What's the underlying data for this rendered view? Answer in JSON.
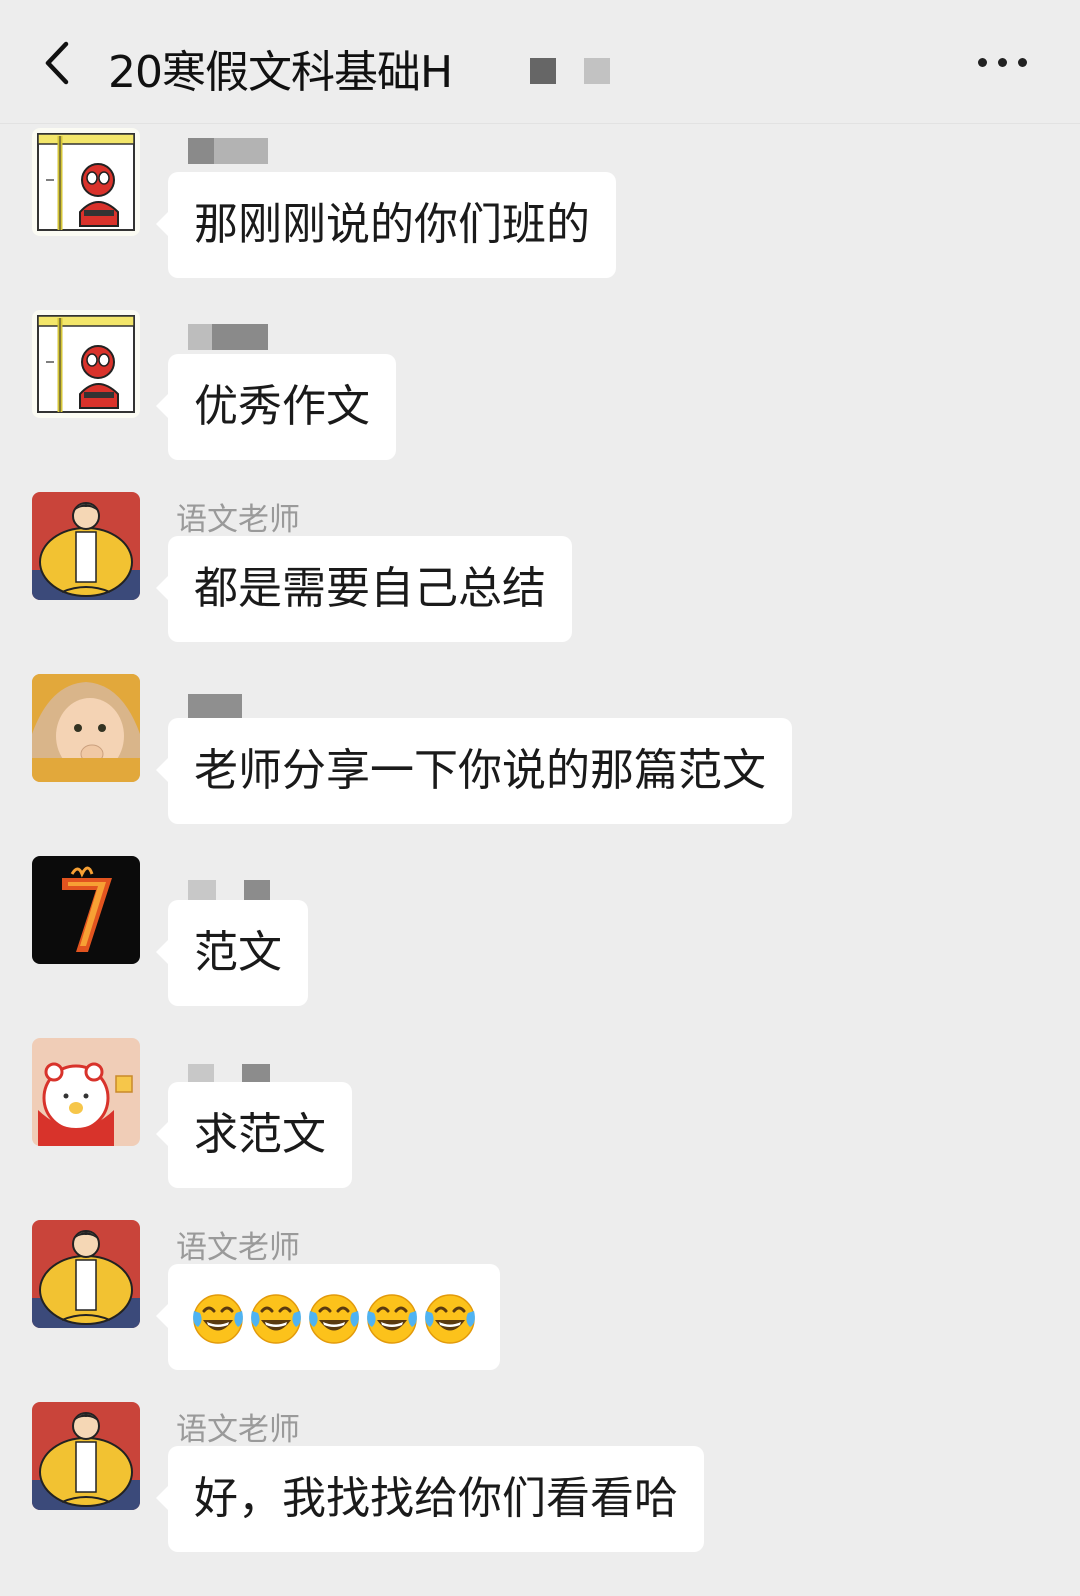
{
  "header": {
    "title": "20寒假文科基础H",
    "back_icon": "chevron-left-icon",
    "more_icon": "more-horizontal-icon"
  },
  "messages": [
    {
      "name": "",
      "avatar": "spiderman-sketch-avatar",
      "text": "那刚刚说的你们班的"
    },
    {
      "name": "",
      "avatar": "spiderman-sketch-avatar",
      "text": "优秀作文"
    },
    {
      "name": "语文老师",
      "avatar": "cartoon-guy-avatar",
      "text": "都是需要自己总结"
    },
    {
      "name": "",
      "avatar": "baby-photo-avatar",
      "text": "老师分享一下你说的那篇范文"
    },
    {
      "name": "",
      "avatar": "flaming-seven-avatar",
      "text": "范文"
    },
    {
      "name": "",
      "avatar": "cartoon-bear-avatar",
      "text": "求范文"
    },
    {
      "name": "语文老师",
      "avatar": "cartoon-guy-avatar",
      "emoji": "tears-of-joy-emoji",
      "emoji_count": 5
    },
    {
      "name": "语文老师",
      "avatar": "cartoon-guy-avatar",
      "text": "好，我找找给你们看看哈"
    }
  ],
  "colors": {
    "background": "#ededed",
    "bubble": "#ffffff",
    "name": "#9a9a9a",
    "text": "#1a1a1a"
  }
}
